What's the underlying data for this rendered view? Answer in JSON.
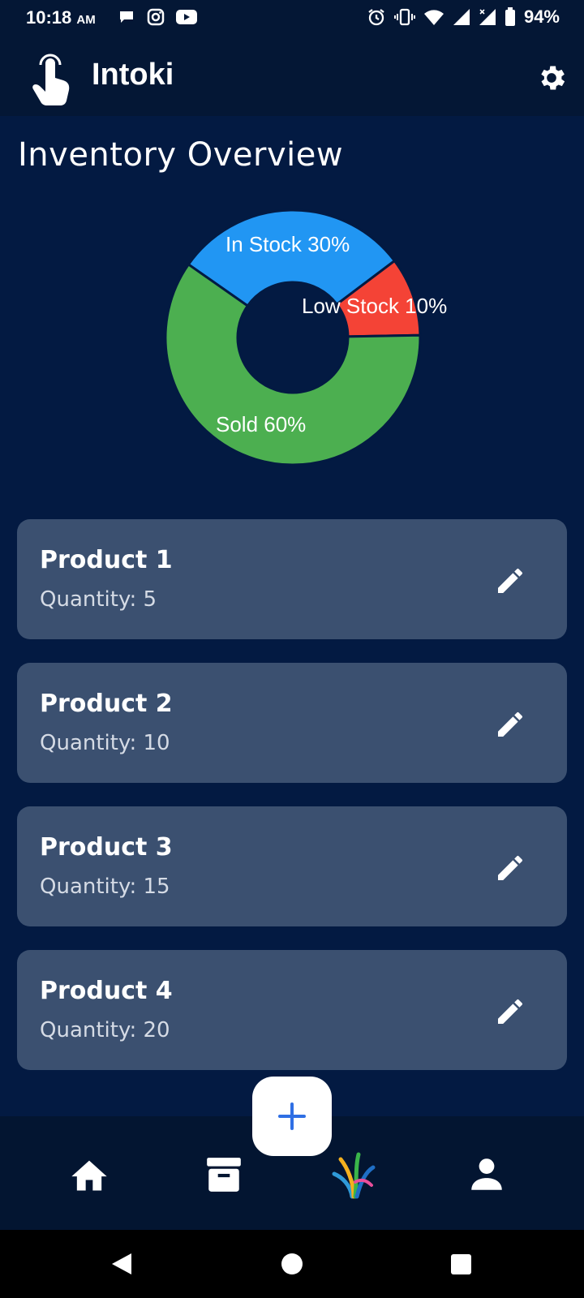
{
  "status": {
    "time": "10:18",
    "ampm": "AM",
    "battery": "94%"
  },
  "app": {
    "title": "Intoki"
  },
  "page": {
    "title": "Inventory Overview"
  },
  "chart_data": {
    "type": "pie",
    "donut": true,
    "slices": [
      {
        "label": "In Stock 30%",
        "value": 30,
        "color": "#2196f3"
      },
      {
        "label": "Low Stock 10%",
        "value": 10,
        "color": "#f44336"
      },
      {
        "label": "Sold 60%",
        "value": 60,
        "color": "#4caf50"
      }
    ]
  },
  "products": [
    {
      "name": "Product 1",
      "quantity": "Quantity: 5"
    },
    {
      "name": "Product 2",
      "quantity": "Quantity: 10"
    },
    {
      "name": "Product 3",
      "quantity": "Quantity: 15"
    },
    {
      "name": "Product 4",
      "quantity": "Quantity: 20"
    }
  ],
  "icons": {
    "logo": "touch-hand-icon",
    "settings": "gear-icon",
    "edit": "pencil-icon",
    "add": "plus-icon",
    "nav": [
      "home-icon",
      "archive-icon",
      "app-logo-icon",
      "person-icon"
    ]
  },
  "colors": {
    "background": "#031a42",
    "card": "#3b5070",
    "accent": "#2f6fe4"
  }
}
